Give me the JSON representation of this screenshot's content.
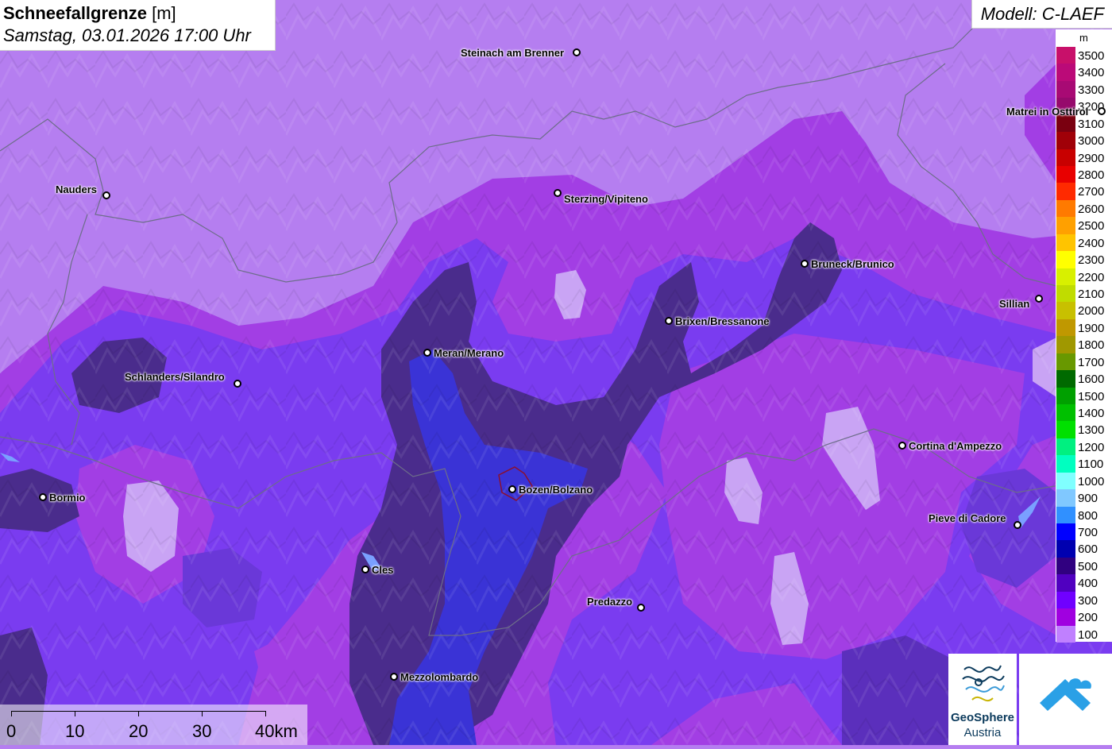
{
  "header": {
    "title": "Schneefallgrenze",
    "unit": "[m]",
    "datetime": "Samstag, 03.01.2026 17:00 Uhr",
    "model": "Modell: C-LAEF"
  },
  "legend": {
    "unit": "m",
    "items": [
      {
        "label": "3500",
        "color": "#c8106a"
      },
      {
        "label": "3400",
        "color": "#bb0a78"
      },
      {
        "label": "3300",
        "color": "#a80a74"
      },
      {
        "label": "3200",
        "color": "#960a6c"
      },
      {
        "label": "3100",
        "color": "#7a0010"
      },
      {
        "label": "3000",
        "color": "#a00008"
      },
      {
        "label": "2900",
        "color": "#c80000"
      },
      {
        "label": "2800",
        "color": "#e80000"
      },
      {
        "label": "2700",
        "color": "#ff2a00"
      },
      {
        "label": "2600",
        "color": "#ff7a00"
      },
      {
        "label": "2500",
        "color": "#ffa000"
      },
      {
        "label": "2400",
        "color": "#ffc400"
      },
      {
        "label": "2300",
        "color": "#ffff00"
      },
      {
        "label": "2200",
        "color": "#d8f000"
      },
      {
        "label": "2100",
        "color": "#c0dc00"
      },
      {
        "label": "2000",
        "color": "#c8c000"
      },
      {
        "label": "1900",
        "color": "#c09800"
      },
      {
        "label": "1800",
        "color": "#a09800"
      },
      {
        "label": "1700",
        "color": "#689800"
      },
      {
        "label": "1600",
        "color": "#006a00"
      },
      {
        "label": "1500",
        "color": "#00a000"
      },
      {
        "label": "1400",
        "color": "#00c000"
      },
      {
        "label": "1300",
        "color": "#00e000"
      },
      {
        "label": "1200",
        "color": "#00f080"
      },
      {
        "label": "1100",
        "color": "#00ffc0"
      },
      {
        "label": "1000",
        "color": "#80ffff"
      },
      {
        "label": "900",
        "color": "#80c8ff"
      },
      {
        "label": "800",
        "color": "#3090ff"
      },
      {
        "label": "700",
        "color": "#0000ff"
      },
      {
        "label": "600",
        "color": "#0000b0"
      },
      {
        "label": "500",
        "color": "#300080"
      },
      {
        "label": "400",
        "color": "#5000c0"
      },
      {
        "label": "300",
        "color": "#7000ff"
      },
      {
        "label": "200",
        "color": "#a000e0"
      },
      {
        "label": "100",
        "color": "#c080ff"
      }
    ]
  },
  "cities": [
    {
      "name": "Steinach am Brenner"
    },
    {
      "name": "Nauders"
    },
    {
      "name": "Sterzing/Vipiteno"
    },
    {
      "name": "Matrei in Osttirol"
    },
    {
      "name": "Bruneck/Brunico"
    },
    {
      "name": "Sillian"
    },
    {
      "name": "Brixen/Bressanone"
    },
    {
      "name": "Meran/Merano"
    },
    {
      "name": "Schlanders/Silandro"
    },
    {
      "name": "Cortina d'Ampezzo"
    },
    {
      "name": "Bozen/Bolzano"
    },
    {
      "name": "Bormio"
    },
    {
      "name": "Pieve di Cadore"
    },
    {
      "name": "Cles"
    },
    {
      "name": "Predazzo"
    },
    {
      "name": "Mezzolombardo"
    }
  ],
  "scale": {
    "labels": [
      "0",
      "10",
      "20",
      "30",
      "40km"
    ]
  },
  "logos": {
    "geosphere_line1": "GeoSphere",
    "geosphere_line2": "Austria",
    "geosphere_icon": "geosphere-logo",
    "second_icon": "weather-app-logo"
  },
  "colors": {
    "zone_100": "#b57ef0",
    "zone_200": "#a33ee6",
    "zone_300": "#7a3cf0",
    "zone_400": "#5a2fb8",
    "zone_500": "#482b88",
    "zone_700": "#3a32d8"
  }
}
